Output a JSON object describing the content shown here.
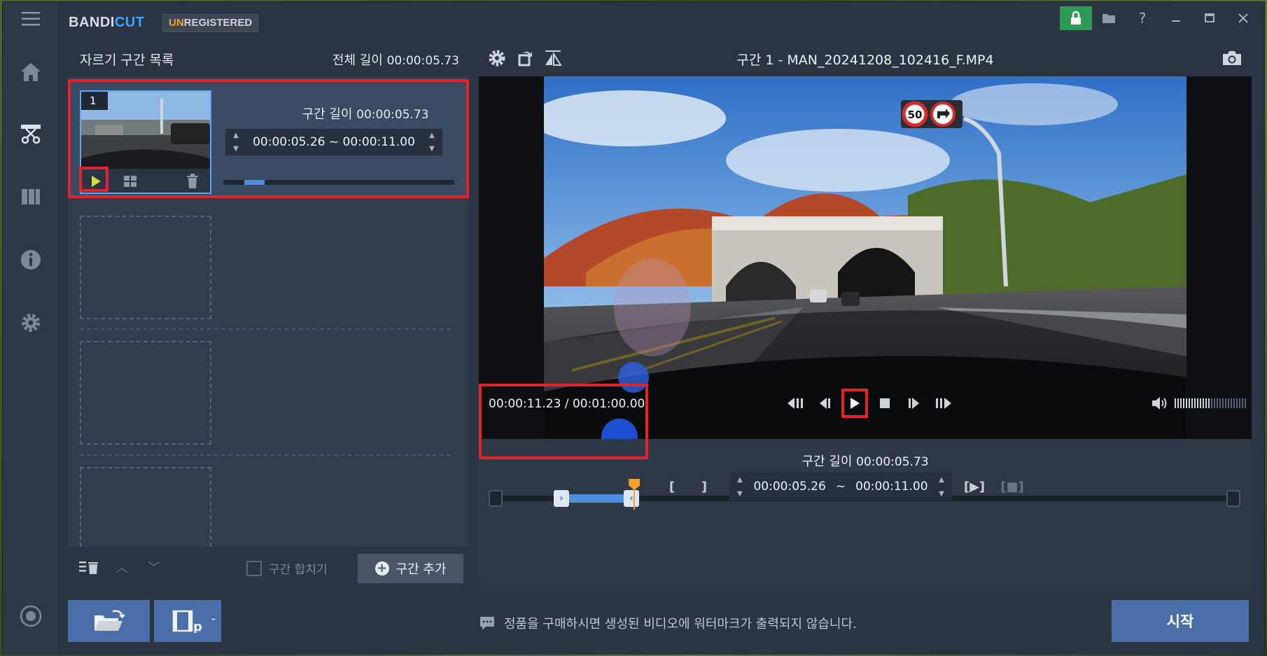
{
  "app": {
    "brand_a": "BANDI",
    "brand_b": "CUT",
    "badge_a": "UN",
    "badge_b": "REGISTERED"
  },
  "titlebar_icons": [
    "lock-icon",
    "folder-icon",
    "help-icon",
    "minimize-icon",
    "maximize-icon",
    "close-icon"
  ],
  "rail": [
    "menu-icon",
    "home-icon",
    "cut-icon",
    "merge-icon",
    "info-icon",
    "settings-icon",
    "record-icon"
  ],
  "left_panel": {
    "title": "자르기 구간 목록",
    "total_label": "전체 길이",
    "total_value": "00:00:05.73",
    "segment": {
      "number": "1",
      "length_label": "구간 길이",
      "length_value": "00:00:05.73",
      "range": "00:00:05.26 ~ 00:00:11.00",
      "progress_start": 0.09,
      "progress_end": 0.18
    },
    "footer": {
      "merge_label": "구간 합치기",
      "add_label": "구간 추가"
    }
  },
  "right_panel": {
    "title": "구간 1 - MAN_20241208_102416_F.MP4",
    "time_current": "00:00:11.23",
    "time_sep": "/",
    "time_total": "00:01:00.00",
    "length_label": "구간 길이",
    "length_value": "00:00:05.73",
    "range_start": "00:00:05.26",
    "range_tilde": "~",
    "range_end": "00:00:11.00",
    "volume_level": 0.5,
    "timeline": {
      "sel_start": 0.0877,
      "sel_end": 0.1833,
      "cursor": 0.1872
    }
  },
  "video_overlay": {
    "speed_sign": "50"
  },
  "bottom": {
    "notice": "정품을 구매하시면 생성된 비디오에 워터마크가 출력되지 않습니다.",
    "start_label": "시작"
  },
  "colors": {
    "accent": "#4a6fa8",
    "highlight": "#e3222a",
    "cursor": "#f0a22a",
    "selection": "#4c8fe0"
  }
}
